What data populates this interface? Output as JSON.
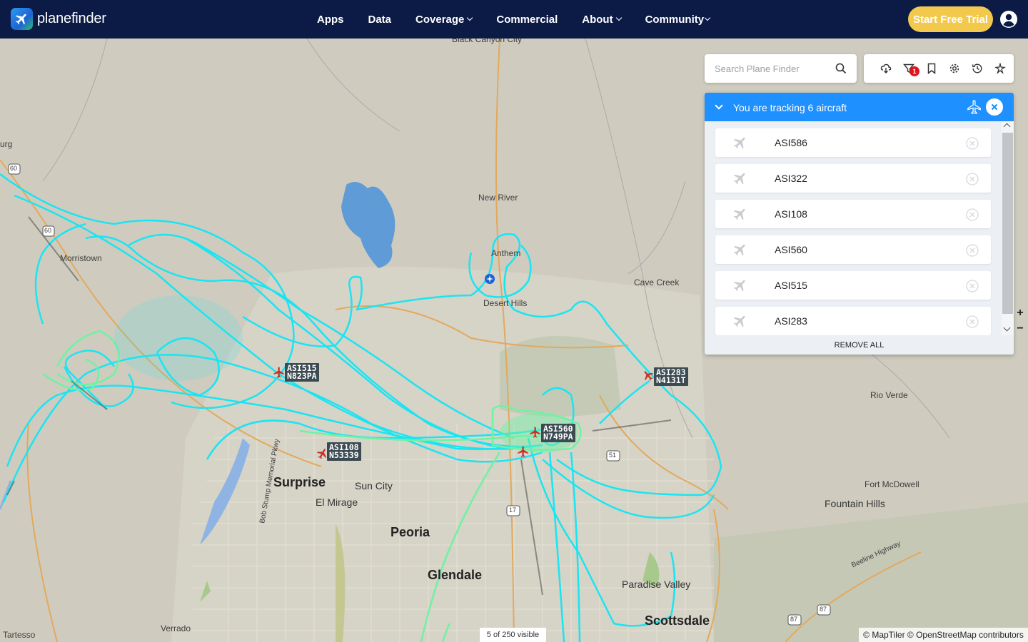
{
  "brand": {
    "name_light": "plane",
    "name_bold": "finder"
  },
  "nav": {
    "items": [
      {
        "label": "Apps"
      },
      {
        "label": "Data"
      },
      {
        "label": "Coverage"
      },
      {
        "label": "Commercial"
      },
      {
        "label": "About"
      },
      {
        "label": "Community"
      }
    ],
    "trial_button": "Start Free Trial",
    "accent_color": "#f2c94c",
    "bar_color": "#0c1b46"
  },
  "search": {
    "placeholder": "Search Plane Finder"
  },
  "toolbar": {
    "icons": [
      "weather-icon",
      "filter-icon",
      "bookmark-icon",
      "settings-icon",
      "history-icon",
      "airspace-icon"
    ],
    "filter_badge": "1"
  },
  "tracking": {
    "title": "You are tracking 6 aircraft",
    "header_color": "#1e90ff",
    "items": [
      {
        "callsign": "ASI586"
      },
      {
        "callsign": "ASI322"
      },
      {
        "callsign": "ASI108"
      },
      {
        "callsign": "ASI560"
      },
      {
        "callsign": "ASI515"
      },
      {
        "callsign": "ASI283"
      }
    ],
    "remove_all": "REMOVE ALL"
  },
  "map": {
    "places": [
      {
        "name": "Black Canyon City",
        "cls": ""
      },
      {
        "name": "urg",
        "cls": ""
      },
      {
        "name": "New River",
        "cls": ""
      },
      {
        "name": "Morristown",
        "cls": ""
      },
      {
        "name": "Anthem",
        "cls": ""
      },
      {
        "name": "Cave Creek",
        "cls": ""
      },
      {
        "name": "Desert Hills",
        "cls": ""
      },
      {
        "name": "Rio Verde",
        "cls": ""
      },
      {
        "name": "Surprise",
        "cls": "big"
      },
      {
        "name": "Sun City",
        "cls": "med"
      },
      {
        "name": "El Mirage",
        "cls": "med"
      },
      {
        "name": "Fort McDowell",
        "cls": ""
      },
      {
        "name": "Fountain Hills",
        "cls": "med"
      },
      {
        "name": "Peoria",
        "cls": "big"
      },
      {
        "name": "Glendale",
        "cls": "big"
      },
      {
        "name": "Paradise Valley",
        "cls": "med"
      },
      {
        "name": "Scottsdale",
        "cls": "big"
      },
      {
        "name": "Verrado",
        "cls": ""
      },
      {
        "name": "Tartesso",
        "cls": ""
      },
      {
        "name": "Bob Stump Memorial Pkwy",
        "cls": ""
      },
      {
        "name": "Beeline Highway",
        "cls": ""
      }
    ],
    "aircraft_labels": [
      {
        "callsign": "ASI515",
        "reg": "N823PA"
      },
      {
        "callsign": "ASI283",
        "reg": "N4131T"
      },
      {
        "callsign": "ASI560",
        "reg": "N749PA"
      },
      {
        "callsign": "ASI108",
        "reg": "N53339"
      }
    ],
    "highway_shields": [
      "60",
      "60",
      "17",
      "51",
      "87",
      "87"
    ],
    "visible_count": "5 of 250 visible",
    "attribution": "© MapTiler © OpenStreetMap contributors",
    "track_colors": [
      "#19e5f2",
      "#6ef2a4"
    ]
  }
}
